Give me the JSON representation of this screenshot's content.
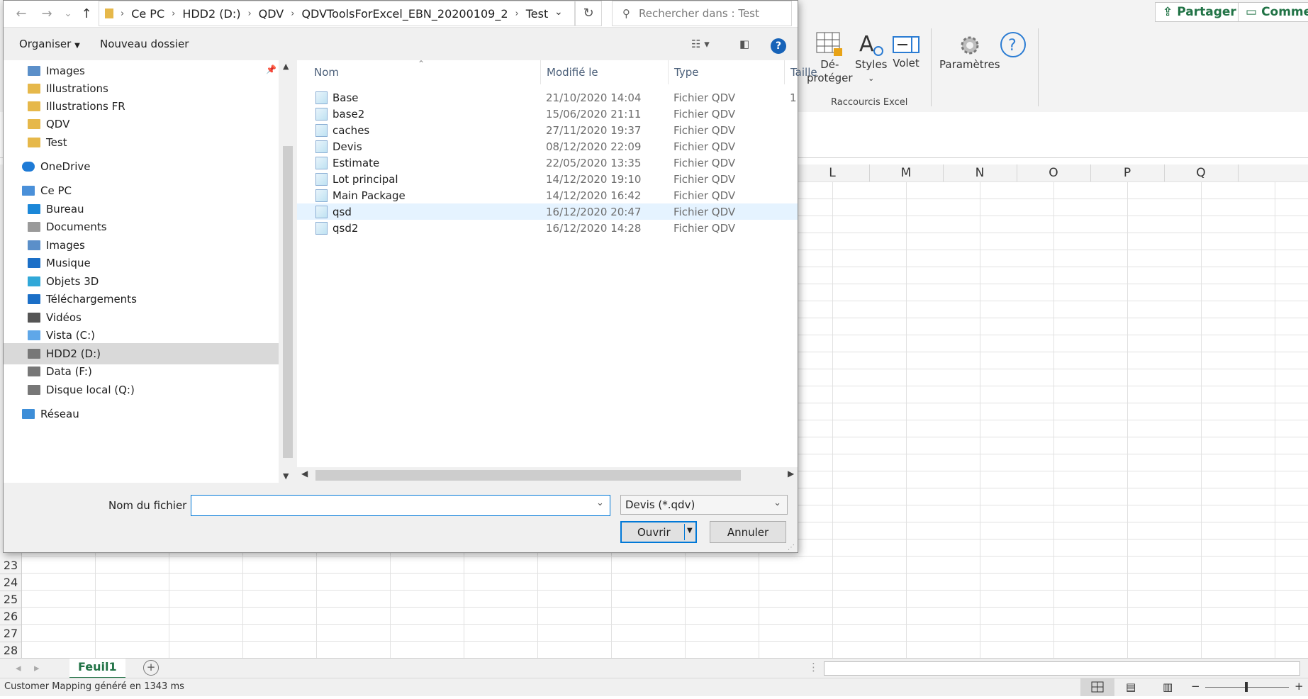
{
  "excel": {
    "share_label": "Partager",
    "comments_label": "Commen",
    "ribbon": {
      "unprotect_label_1": "Dé-",
      "unprotect_label_2": "protéger",
      "styles_label": "Styles",
      "volet_label": "Volet",
      "params_label": "Paramètres",
      "group_label": "Raccourcis Excel"
    },
    "columns": [
      "L",
      "M",
      "N",
      "O",
      "P",
      "Q"
    ],
    "rows": [
      "23",
      "24",
      "25",
      "26",
      "27",
      "28"
    ],
    "sheet_tab": "Feuil1",
    "status_text": "Customer Mapping généré en 1343 ms"
  },
  "dialog": {
    "breadcrumb": [
      "Ce PC",
      "HDD2 (D:)",
      "QDV",
      "QDVToolsForExcel_EBN_20200109_2",
      "Test"
    ],
    "search_placeholder": "Rechercher dans : Test",
    "toolbar": {
      "organize": "Organiser",
      "new_folder": "Nouveau dossier"
    },
    "nav_items": [
      {
        "label": "Images",
        "icon": "images-icon",
        "indent": 2
      },
      {
        "label": "Illustrations",
        "icon": "folder-icon",
        "indent": 2
      },
      {
        "label": "Illustrations FR",
        "icon": "folder-icon",
        "indent": 2
      },
      {
        "label": "QDV",
        "icon": "folder-icon",
        "indent": 2
      },
      {
        "label": "Test",
        "icon": "folder-icon",
        "indent": 2
      },
      {
        "label": "OneDrive",
        "icon": "cloud-icon",
        "indent": 1
      },
      {
        "label": "Ce PC",
        "icon": "computer-icon",
        "indent": 1
      },
      {
        "label": "Bureau",
        "icon": "desktop-icon",
        "indent": 2
      },
      {
        "label": "Documents",
        "icon": "documents-icon",
        "indent": 2
      },
      {
        "label": "Images",
        "icon": "images-icon",
        "indent": 2
      },
      {
        "label": "Musique",
        "icon": "music-icon",
        "indent": 2
      },
      {
        "label": "Objets 3D",
        "icon": "cube-icon",
        "indent": 2
      },
      {
        "label": "Téléchargements",
        "icon": "download-icon",
        "indent": 2
      },
      {
        "label": "Vidéos",
        "icon": "video-icon",
        "indent": 2
      },
      {
        "label": "Vista (C:)",
        "icon": "windows-drive-icon",
        "indent": 2
      },
      {
        "label": "HDD2 (D:)",
        "icon": "drive-icon",
        "indent": 2,
        "selected": true
      },
      {
        "label": "Data (F:)",
        "icon": "drive-icon",
        "indent": 2
      },
      {
        "label": "Disque local (Q:)",
        "icon": "drive-icon",
        "indent": 2
      },
      {
        "label": "Réseau",
        "icon": "network-icon",
        "indent": 1
      }
    ],
    "columns": {
      "name": "Nom",
      "modified": "Modifié le",
      "type": "Type",
      "size": "Taille"
    },
    "files": [
      {
        "name": "Base",
        "modified": "21/10/2020 14:04",
        "type": "Fichier QDV",
        "size": "1"
      },
      {
        "name": "base2",
        "modified": "15/06/2020 21:11",
        "type": "Fichier QDV",
        "size": ""
      },
      {
        "name": "caches",
        "modified": "27/11/2020 19:37",
        "type": "Fichier QDV",
        "size": ""
      },
      {
        "name": "Devis",
        "modified": "08/12/2020 22:09",
        "type": "Fichier QDV",
        "size": ""
      },
      {
        "name": "Estimate",
        "modified": "22/05/2020 13:35",
        "type": "Fichier QDV",
        "size": ""
      },
      {
        "name": "Lot principal",
        "modified": "14/12/2020 19:10",
        "type": "Fichier QDV",
        "size": ""
      },
      {
        "name": "Main Package",
        "modified": "14/12/2020 16:42",
        "type": "Fichier QDV",
        "size": ""
      },
      {
        "name": "qsd",
        "modified": "16/12/2020 20:47",
        "type": "Fichier QDV",
        "size": "",
        "selected": true
      },
      {
        "name": "qsd2",
        "modified": "16/12/2020 14:28",
        "type": "Fichier QDV",
        "size": ""
      }
    ],
    "filename_label": "Nom du fichier :",
    "filename_value": "",
    "filetype_value": "Devis (*.qdv)",
    "open_label": "Ouvrir",
    "cancel_label": "Annuler"
  },
  "colors": {
    "accent": "#0078d7",
    "excel_green": "#217346",
    "selection": "#e5f3ff"
  }
}
